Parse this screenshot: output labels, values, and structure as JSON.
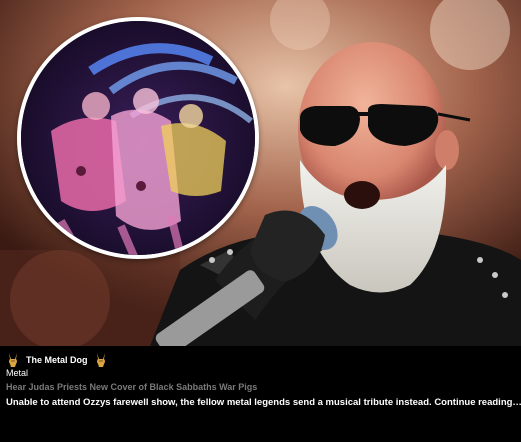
{
  "source": {
    "name": "The Metal Dog",
    "icon": "metal-horns-icon"
  },
  "category": "Metal",
  "headline": "Hear Judas Priests New Cover of Black Sabbaths War Pigs",
  "summary": {
    "text": "Unable to attend Ozzys farewell show, the fellow metal legends send a musical tribute instead.",
    "more_link": "Continue reading…"
  },
  "colors": {
    "background": "#000000",
    "headline": "#7a7a7a",
    "text": "#ffffff",
    "horns": "#d9a441"
  }
}
